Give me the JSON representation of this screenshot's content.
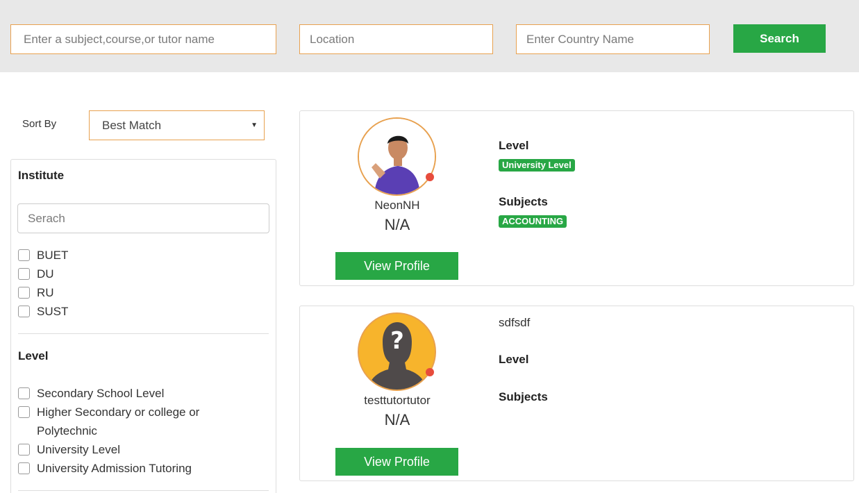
{
  "search_bar": {
    "subject_placeholder": "Enter a subject,course,or tutor name",
    "location_placeholder": "Location",
    "country_placeholder": "Enter Country Name",
    "search_label": "Search"
  },
  "sort": {
    "label": "Sort By",
    "selected": "Best Match"
  },
  "filters": {
    "institute": {
      "title": "Institute",
      "search_placeholder": "Serach",
      "options": [
        "BUET",
        "DU",
        "RU",
        "SUST"
      ]
    },
    "level": {
      "title": "Level",
      "options": [
        "Secondary School Level",
        "Higher Secondary or college or Polytechnic",
        "University Level",
        "University Admission Tutoring"
      ]
    }
  },
  "tutors": [
    {
      "name": "NeonNH",
      "rating": "N/A",
      "view_label": "View Profile",
      "level_title": "Level",
      "level_badge": "University Level",
      "subjects_title": "Subjects",
      "subject_badge": "ACCOUNTING"
    },
    {
      "name": "testtutortutor",
      "rating": "N/A",
      "view_label": "View Profile",
      "headline": "sdfsdf",
      "level_title": "Level",
      "subjects_title": "Subjects"
    }
  ],
  "colors": {
    "accent_green": "#28a745",
    "border_orange": "#e8a14f",
    "online_dot": "#e74c3c",
    "topbar_bg": "#e8e8e8"
  }
}
